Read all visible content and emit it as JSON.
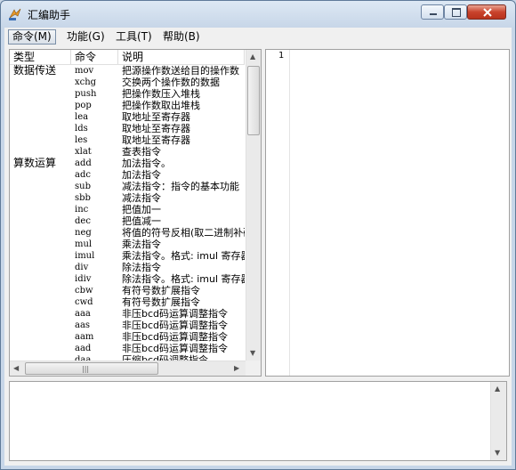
{
  "window": {
    "title": "汇编助手",
    "controls": {
      "minimize": "minimize",
      "maximize": "maximize",
      "close": "close"
    }
  },
  "menu": [
    {
      "label": "命令(M)",
      "active": true
    },
    {
      "label": "功能(G)",
      "active": false
    },
    {
      "label": "工具(T)",
      "active": false
    },
    {
      "label": "帮助(B)",
      "active": false
    }
  ],
  "list": {
    "headers": [
      "类型",
      "命令",
      "说明"
    ],
    "rows": [
      {
        "type": "数据传送",
        "cmd": "mov",
        "desc": "把源操作数送给目的操作数"
      },
      {
        "type": "",
        "cmd": "xchg",
        "desc": "交换两个操作数的数据"
      },
      {
        "type": "",
        "cmd": "push",
        "desc": "把操作数压入堆栈"
      },
      {
        "type": "",
        "cmd": "pop",
        "desc": "把操作数取出堆栈"
      },
      {
        "type": "",
        "cmd": "lea",
        "desc": "取地址至寄存器"
      },
      {
        "type": "",
        "cmd": "lds",
        "desc": "取地址至寄存器"
      },
      {
        "type": "",
        "cmd": "les",
        "desc": "取地址至寄存器"
      },
      {
        "type": "",
        "cmd": "xlat",
        "desc": "查表指令"
      },
      {
        "type": "算数运算",
        "cmd": "add",
        "desc": "加法指令。"
      },
      {
        "type": "",
        "cmd": "adc",
        "desc": "加法指令"
      },
      {
        "type": "",
        "cmd": "sub",
        "desc": "减法指令：指令的基本功能"
      },
      {
        "type": "",
        "cmd": "sbb",
        "desc": "减法指令"
      },
      {
        "type": "",
        "cmd": "inc",
        "desc": "把值加一"
      },
      {
        "type": "",
        "cmd": "dec",
        "desc": "把值减一"
      },
      {
        "type": "",
        "cmd": "neg",
        "desc": "将值的符号反相(取二进制补码)"
      },
      {
        "type": "",
        "cmd": "mul",
        "desc": "乘法指令"
      },
      {
        "type": "",
        "cmd": "imul",
        "desc": "乘法指令。格式: imul 寄存器"
      },
      {
        "type": "",
        "cmd": "div",
        "desc": "除法指令"
      },
      {
        "type": "",
        "cmd": "idiv",
        "desc": "除法指令。格式: imul 寄存器"
      },
      {
        "type": "",
        "cmd": "cbw",
        "desc": "有符号数扩展指令"
      },
      {
        "type": "",
        "cmd": "cwd",
        "desc": "有符号数扩展指令"
      },
      {
        "type": "",
        "cmd": "aaa",
        "desc": "非压bcd码运算调整指令"
      },
      {
        "type": "",
        "cmd": "aas",
        "desc": "非压bcd码运算调整指令"
      },
      {
        "type": "",
        "cmd": "aam",
        "desc": "非压bcd码运算调整指令"
      },
      {
        "type": "",
        "cmd": "aad",
        "desc": "非压bcd码运算调整指令"
      },
      {
        "type": "",
        "cmd": "daa",
        "desc": "压缩bcd码调整指令"
      }
    ]
  },
  "editor": {
    "line_number": "1"
  },
  "colors": {
    "close_button": "#c9432c",
    "title_bg": "#dde8f4"
  }
}
